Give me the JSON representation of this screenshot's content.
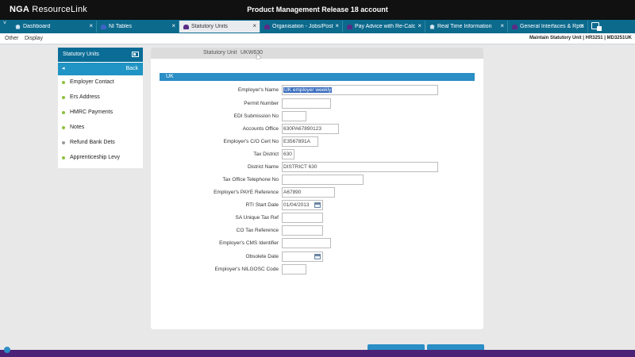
{
  "titlebar": {
    "logo_bold": "NGA",
    "logo_light": " ResourceLink",
    "title": "Product Management Release 18 account"
  },
  "tabs": [
    {
      "label": "Dashboard",
      "icon": "home-icon",
      "close": "×"
    },
    {
      "label": "NI Tables",
      "icon": "blue-folder-icon",
      "close": "×"
    },
    {
      "label": "Statutory Units",
      "icon": "purple-folder-icon",
      "close": "×"
    },
    {
      "label": "Organisation - Jobs/Post",
      "icon": "purple-folder-icon",
      "close": "×"
    },
    {
      "label": "Pay Advice with Re-Calc",
      "icon": "purple-folder-icon",
      "close": "×"
    },
    {
      "label": "Real Time Information",
      "icon": "home-icon",
      "close": "×"
    },
    {
      "label": "General Interfaces & Rpts",
      "icon": "purple-folder-icon",
      "close": "×"
    }
  ],
  "tab_menu_glyph": "˅",
  "menubar": {
    "items": [
      "Other",
      "Display"
    ],
    "breadcrumb": "Maintain Statutory Unit | HR3251 | MD3251UK"
  },
  "sidebar": {
    "title": "Statutory Units",
    "back_arrow": "◂",
    "back_label": "Back",
    "items": [
      {
        "label": "Employer Contact",
        "status": "green"
      },
      {
        "label": "Ers Address",
        "status": "green"
      },
      {
        "label": "HMRC Payments",
        "status": "green"
      },
      {
        "label": "Notes",
        "status": "green"
      },
      {
        "label": "Refund Bank Dets",
        "status": "grey"
      },
      {
        "label": "Apprenticeship Levy",
        "status": "green"
      }
    ]
  },
  "panel": {
    "header_label": "Statutory Unit",
    "header_value": "UKW630",
    "section": "UK",
    "fields": [
      {
        "label": "Employer's Name",
        "value": "UK employer weekly"
      },
      {
        "label": "Permit Number",
        "value": ""
      },
      {
        "label": "EDI Submission No",
        "value": ""
      },
      {
        "label": "Accounts Office",
        "value": "630PA67890123"
      },
      {
        "label": "Employer's C/O Cert No",
        "value": "E3567891A"
      },
      {
        "label": "Tax District",
        "value": "630"
      },
      {
        "label": "District Name",
        "value": "DISTRICT 630"
      },
      {
        "label": "Tax Office Telephone No",
        "value": ""
      },
      {
        "label": "Employer's PAYE Reference",
        "value": "A67890"
      },
      {
        "label": "RTI Start Date",
        "value": "01/04/2013"
      },
      {
        "label": "SA Unique Tax Ref",
        "value": ""
      },
      {
        "label": "CO Tax Reference",
        "value": ""
      },
      {
        "label": "Employer's CMS Identifier",
        "value": ""
      },
      {
        "label": "Obsolete Date",
        "value": ""
      },
      {
        "label": "Employer's NILGOSC Code",
        "value": ""
      }
    ]
  }
}
